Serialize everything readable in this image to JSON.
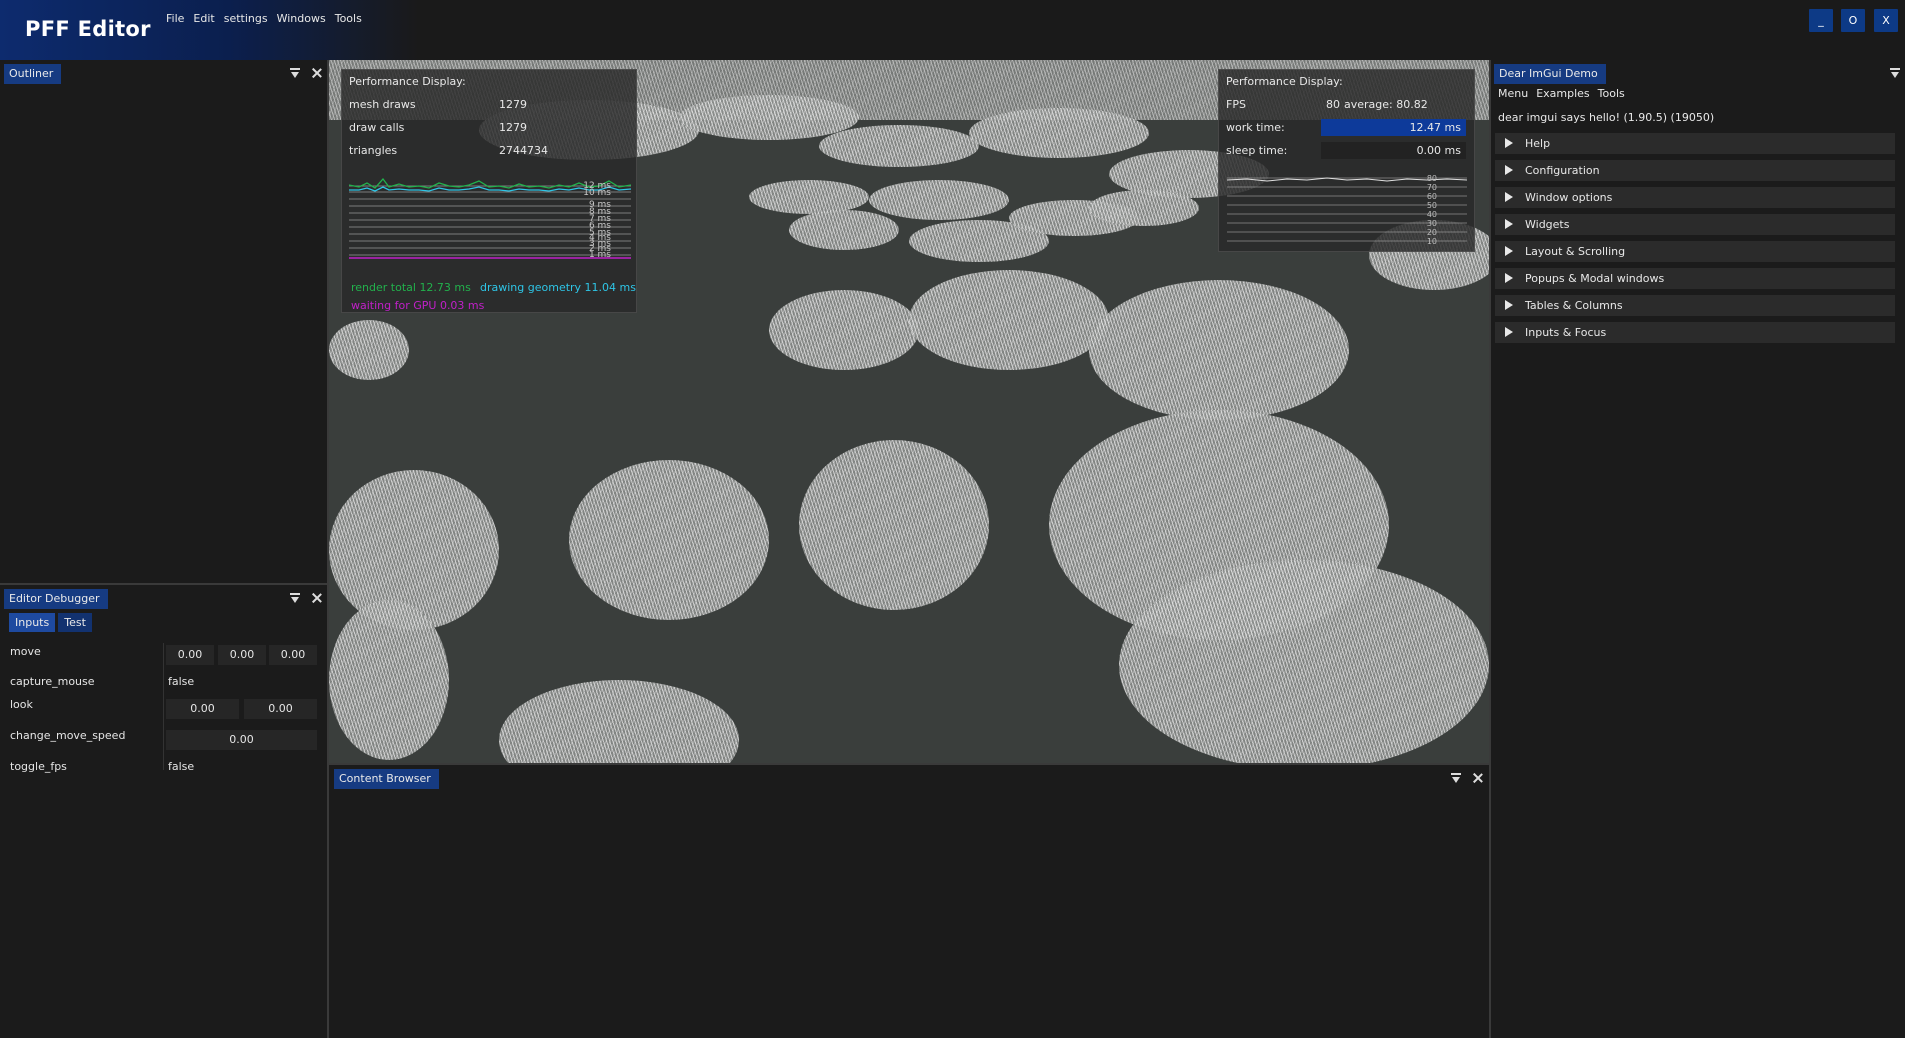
{
  "app": {
    "title": "PFF Editor"
  },
  "menu": [
    "File",
    "Edit",
    "settings",
    "Windows",
    "Tools"
  ],
  "window_controls": {
    "minimize": "_",
    "maximize": "O",
    "close": "X"
  },
  "outliner": {
    "title": "Outliner"
  },
  "editor_debugger": {
    "title": "Editor Debugger",
    "tabs": [
      "Inputs",
      "Test"
    ],
    "rows": {
      "move": {
        "label": "move",
        "values": [
          "0.00",
          "0.00",
          "0.00"
        ]
      },
      "capture_mouse": {
        "label": "capture_mouse",
        "value": "false"
      },
      "look": {
        "label": "look",
        "values": [
          "0.00",
          "0.00"
        ]
      },
      "change_move_speed": {
        "label": "change_move_speed",
        "value": "0.00"
      },
      "toggle_fps": {
        "label": "toggle_fps",
        "value": "false"
      }
    }
  },
  "perf_left": {
    "title": "Performance Display:",
    "rows": [
      {
        "label": "mesh draws",
        "value": "1279"
      },
      {
        "label": "draw calls",
        "value": "1279"
      },
      {
        "label": "triangles",
        "value": "2744734"
      }
    ],
    "ticks": [
      "12 ms",
      "10 ms",
      "9 ms",
      "8 ms",
      "7 ms",
      "6 ms",
      "5 ms",
      "4 ms",
      "3 ms",
      "2 ms",
      "1 ms"
    ],
    "legend": {
      "render_total": "render total 12.73 ms",
      "drawing_geometry": "drawing geometry 11.04 ms",
      "waiting_gpu": "waiting for GPU 0.03 ms"
    },
    "colors": {
      "render_total": "#22b14c",
      "drawing_geometry": "#2ec5e6",
      "waiting_gpu": "#c020c8"
    }
  },
  "perf_right": {
    "title": "Performance Display:",
    "fps": {
      "label": "FPS",
      "value": "80",
      "average": "average: 80.82"
    },
    "work_time": {
      "label": "work time:",
      "value": "12.47 ms"
    },
    "sleep_time": {
      "label": "sleep time:",
      "value": "0.00 ms"
    },
    "ticks": [
      "80",
      "70",
      "60",
      "50",
      "40",
      "30",
      "20",
      "10"
    ]
  },
  "demo": {
    "title": "Dear ImGui Demo",
    "menu": [
      "Menu",
      "Examples",
      "Tools"
    ],
    "hello": "dear imgui says hello! (1.90.5) (19050)",
    "sections": [
      "Help",
      "Configuration",
      "Window options",
      "Widgets",
      "Layout & Scrolling",
      "Popups & Modal windows",
      "Tables & Columns",
      "Inputs & Focus"
    ]
  },
  "content_browser": {
    "title": "Content Browser"
  },
  "colors": {
    "accent": "#163b82",
    "panel_bg": "#1b1b1b",
    "viewport_ground": "#3a3e3c"
  }
}
